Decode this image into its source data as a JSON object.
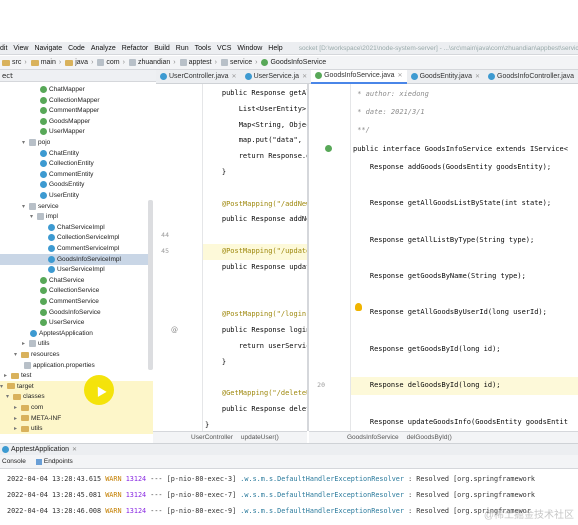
{
  "menubar": {
    "items": [
      "dit",
      "View",
      "Navigate",
      "Code",
      "Analyze",
      "Refactor",
      "Build",
      "Run",
      "Tools",
      "VCS",
      "Window",
      "Help"
    ],
    "title": "socket [D:\\workspace\\2021\\node-system-server] - ...\\src\\main\\java\\com\\zhuandian\\appbest\\service\\GoodsInfoService.java"
  },
  "breadcrumb": [
    "src",
    "main",
    "java",
    "com",
    "zhuandian",
    "apptest",
    "service",
    "GoodsInfoService"
  ],
  "project_label": "ect",
  "tabs": [
    {
      "label": "UserController.java",
      "active": false
    },
    {
      "label": "UserService.ja",
      "active": false
    },
    {
      "label": "GoodsInfoService.java",
      "active": true
    },
    {
      "label": "GoodsEntity.java",
      "active": false
    },
    {
      "label": "GoodsInfoController.java",
      "active": false
    }
  ],
  "tree": [
    {
      "label": "ChatMapper",
      "icon": "int",
      "indent": 40,
      "sel": false
    },
    {
      "label": "CollectionMapper",
      "icon": "int",
      "indent": 40,
      "sel": false
    },
    {
      "label": "CommentMapper",
      "icon": "int",
      "indent": 40,
      "sel": false
    },
    {
      "label": "GoodsMapper",
      "icon": "int",
      "indent": 40,
      "sel": false
    },
    {
      "label": "UserMapper",
      "icon": "int",
      "indent": 40,
      "sel": false
    },
    {
      "label": "pojo",
      "icon": "pkg",
      "indent": 22,
      "sel": false,
      "arrow": "v"
    },
    {
      "label": "ChatEntity",
      "icon": "cls",
      "indent": 40,
      "sel": false
    },
    {
      "label": "CollectionEntity",
      "icon": "cls",
      "indent": 40,
      "sel": false
    },
    {
      "label": "CommentEntity",
      "icon": "cls",
      "indent": 40,
      "sel": false
    },
    {
      "label": "GoodsEntity",
      "icon": "cls",
      "indent": 40,
      "sel": false
    },
    {
      "label": "UserEntity",
      "icon": "cls",
      "indent": 40,
      "sel": false
    },
    {
      "label": "service",
      "icon": "pkg",
      "indent": 22,
      "sel": false,
      "arrow": "v"
    },
    {
      "label": "impl",
      "icon": "pkg",
      "indent": 30,
      "sel": false,
      "arrow": "v"
    },
    {
      "label": "ChatServiceImpl",
      "icon": "cls",
      "indent": 48,
      "sel": false
    },
    {
      "label": "CollectionServiceImpl",
      "icon": "cls",
      "indent": 48,
      "sel": false
    },
    {
      "label": "CommentServiceImpl",
      "icon": "cls",
      "indent": 48,
      "sel": false
    },
    {
      "label": "GoodsInfoServiceImpl",
      "icon": "cls",
      "indent": 48,
      "sel": true
    },
    {
      "label": "UserServiceImpl",
      "icon": "cls",
      "indent": 48,
      "sel": false
    },
    {
      "label": "ChatService",
      "icon": "int",
      "indent": 40,
      "sel": false
    },
    {
      "label": "CollectionService",
      "icon": "int",
      "indent": 40,
      "sel": false
    },
    {
      "label": "CommentService",
      "icon": "int",
      "indent": 40,
      "sel": false
    },
    {
      "label": "GoodsInfoService",
      "icon": "int",
      "indent": 40,
      "sel": false
    },
    {
      "label": "UserService",
      "icon": "int",
      "indent": 40,
      "sel": false
    },
    {
      "label": "ApptestApplication",
      "icon": "cls",
      "indent": 30,
      "sel": false
    },
    {
      "label": "utils",
      "icon": "pkg",
      "indent": 22,
      "sel": false,
      "arrow": ">"
    },
    {
      "label": "resources",
      "icon": "folder",
      "indent": 14,
      "sel": false,
      "arrow": "v"
    },
    {
      "label": "application.properties",
      "icon": "file",
      "indent": 24,
      "sel": false
    },
    {
      "label": "test",
      "icon": "folder",
      "indent": 4,
      "sel": false,
      "arrow": ">"
    },
    {
      "label": "target",
      "icon": "folder",
      "indent": 0,
      "sel": false,
      "arrow": "v",
      "hl": true
    },
    {
      "label": "classes",
      "icon": "folder",
      "indent": 6,
      "sel": false,
      "arrow": "v",
      "hl": true
    },
    {
      "label": "com",
      "icon": "folder",
      "indent": 14,
      "sel": false,
      "arrow": ">",
      "hl": true
    },
    {
      "label": "META-INF",
      "icon": "folder",
      "indent": 14,
      "sel": false,
      "arrow": ">",
      "hl": true
    },
    {
      "label": "utils",
      "icon": "folder",
      "indent": 14,
      "sel": false,
      "arrow": ">",
      "hl": true
    }
  ],
  "editor_left": [
    {
      "text": "    public Response getAll",
      "kind": "mix"
    },
    {
      "text": "        List<UserEntity> li",
      "kind": "plain"
    },
    {
      "text": "        Map<String, Object>",
      "kind": "plain"
    },
    {
      "text": "        map.put(\"data\", ",
      "kind": "plain"
    },
    {
      "text": "        return Response.ok(",
      "kind": "plain"
    },
    {
      "text": "    }",
      "kind": "plain"
    },
    {
      "text": "",
      "kind": "plain"
    },
    {
      "text": "    @PostMapping(\"/addNewUs",
      "kind": "ann"
    },
    {
      "text": "    public Response addNewU",
      "kind": "plain"
    },
    {
      "text": "",
      "kind": "plain"
    },
    {
      "text": "    @PostMapping(\"/updateUs",
      "kind": "ann"
    },
    {
      "text": "    public Response updateU",
      "kind": "plain"
    },
    {
      "text": "",
      "kind": "plain"
    },
    {
      "text": "",
      "kind": "plain"
    },
    {
      "text": "    @PostMapping(\"/login\")",
      "kind": "ann"
    },
    {
      "text": "    public Response login(@",
      "kind": "plain"
    },
    {
      "text": "        return userService.",
      "kind": "plain"
    },
    {
      "text": "    }",
      "kind": "plain"
    },
    {
      "text": "",
      "kind": "plain"
    },
    {
      "text": "    @GetMapping(\"/deleteUse",
      "kind": "ann"
    },
    {
      "text": "    public Response deleteU",
      "kind": "plain"
    },
    {
      "text": "}",
      "kind": "plain"
    }
  ],
  "left_line_numbers": [
    "44",
    "45"
  ],
  "editor_right": [
    {
      "text": " * author: xiedong",
      "kind": "cmt"
    },
    {
      "text": " * date: 2021/3/1",
      "kind": "cmt"
    },
    {
      "text": " **/",
      "kind": "cmt"
    },
    {
      "text": "public interface GoodsInfoService extends IService<",
      "kind": "decl"
    },
    {
      "text": "    Response addGoods(GoodsEntity goodsEntity);",
      "kind": "plain"
    },
    {
      "text": "",
      "kind": "plain"
    },
    {
      "text": "    Response getAllGoodsListByState(int state);",
      "kind": "int"
    },
    {
      "text": "",
      "kind": "plain"
    },
    {
      "text": "    Response getAllListByType(String type);",
      "kind": "plain"
    },
    {
      "text": "",
      "kind": "plain"
    },
    {
      "text": "    Response getGoodsByName(String type);",
      "kind": "plain"
    },
    {
      "text": "",
      "kind": "plain"
    },
    {
      "text": "    Response getAllGoodsByUserId(long userId);",
      "kind": "long"
    },
    {
      "text": "",
      "kind": "plain"
    },
    {
      "text": "    Response getGoodsById(long id);",
      "kind": "long"
    },
    {
      "text": "",
      "kind": "plain"
    },
    {
      "text": "    Response delGoodsById(long id);",
      "kind": "long"
    },
    {
      "text": "",
      "kind": "plain"
    },
    {
      "text": "    Response updateGoodsInfo(GoodsEntity goodsEntit",
      "kind": "plain"
    },
    {
      "text": "}",
      "kind": "plain"
    }
  ],
  "right_line_number": "20",
  "status_left": [
    "UserController",
    "updateUser()"
  ],
  "status_right": [
    "GoodsInfoService",
    "delGoodsById()"
  ],
  "run_tab": "ApptestApplication",
  "run_subtabs": [
    "Console",
    "Endpoints"
  ],
  "logs": [
    {
      "time": "2022-04-04 13:28:43.615",
      "level": "WARN",
      "pid": "13124",
      "sep": "---",
      "thread": "[p-nio-80-exec-3]",
      "logger": ".w.s.m.s.DefaultHandlerExceptionResolver",
      "msg": ": Resolved [org.springframework"
    },
    {
      "time": "2022-04-04 13:28:45.081",
      "level": "WARN",
      "pid": "13124",
      "sep": "---",
      "thread": "[p-nio-80-exec-7]",
      "logger": ".w.s.m.s.DefaultHandlerExceptionResolver",
      "msg": ": Resolved [org.springframework"
    },
    {
      "time": "2022-04-04 13:28:46.008",
      "level": "WARN",
      "pid": "13124",
      "sep": "---",
      "thread": "[p-nio-80-exec-9]",
      "logger": ".w.s.m.s.DefaultHandlerExceptionResolver",
      "msg": ": Resolved [org.springframewor"
    }
  ],
  "watermark": "@稀土掘金技术社区"
}
